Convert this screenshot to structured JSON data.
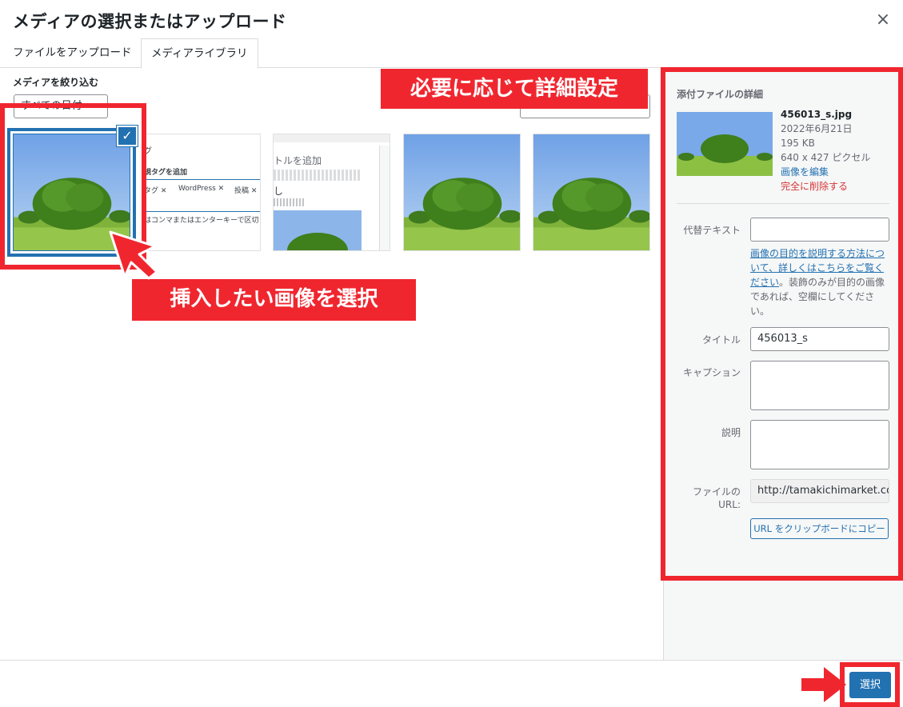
{
  "modal": {
    "title": "メディアの選択またはアップロード",
    "close_icon": "×"
  },
  "tabs": [
    {
      "label": "ファイルをアップロード",
      "active": false
    },
    {
      "label": "メディアライブラリ",
      "active": true
    }
  ],
  "filter": {
    "label": "メディアを絞り込む",
    "date_select": "すべての日付"
  },
  "grid": {
    "items": [
      {
        "type": "tree-photo",
        "selected": true
      },
      {
        "type": "tags-screenshot",
        "selected": false,
        "texts": {
          "title_fragment": "グ",
          "add_tag": "規タグを追加",
          "tags": [
            "タグ ✕",
            "WordPress ✕",
            "投稿 ✕"
          ],
          "hint": "はコンマまたはエンターキーで区切りま"
        }
      },
      {
        "type": "editor-screenshot",
        "selected": false,
        "texts": {
          "title_fragment": "トルを追加",
          "body_fragment": "し"
        }
      },
      {
        "type": "tree-photo",
        "selected": false
      },
      {
        "type": "tree-photo",
        "selected": false
      }
    ]
  },
  "callouts": {
    "select_image": "挿入したい画像を選択",
    "details": "必要に応じて詳細設定"
  },
  "details": {
    "heading": "添付ファイルの詳細",
    "filename": "456013_s.jpg",
    "date": "2022年6月21日",
    "size": "195 KB",
    "dimensions": "640 x 427 ピクセル",
    "edit_link": "画像を編集",
    "delete_link": "完全に削除する",
    "alt_label": "代替テキスト",
    "alt_value": "",
    "alt_help_link": "画像の目的を説明する方法について、詳しくはこちらをご覧ください",
    "alt_help_text": "。装飾のみが目的の画像であれば、空欄にしてください。",
    "title_label": "タイトル",
    "title_value": "456013_s",
    "caption_label": "キャプション",
    "caption_value": "",
    "description_label": "説明",
    "description_value": "",
    "url_label": "ファイルの URL:",
    "url_value": "http://tamakichimarket.co",
    "copy_button": "URL をクリップボードにコピー"
  },
  "toolbar": {
    "select_button": "選択"
  },
  "colors": {
    "accent": "#2271b1",
    "annotation": "#f0262f",
    "danger": "#d63638"
  }
}
